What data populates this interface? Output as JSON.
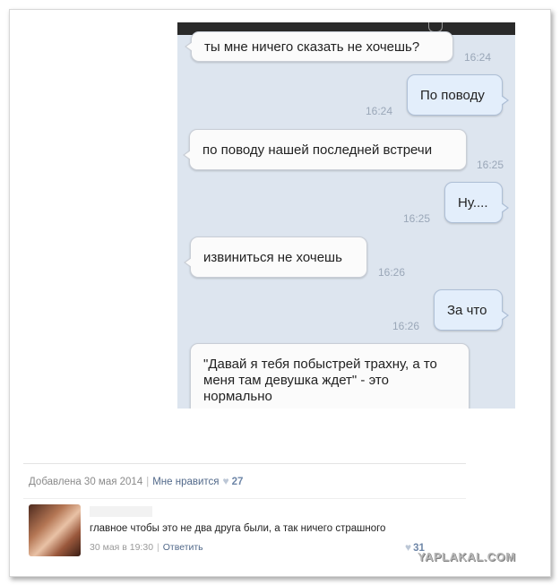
{
  "messages": [
    {
      "text": "ты мне ничего сказать не хочешь?",
      "time": "16:24",
      "dir": "in"
    },
    {
      "text": "По поводу",
      "time": "16:24",
      "dir": "out"
    },
    {
      "text": "по поводу нашей последней встречи",
      "time": "16:25",
      "dir": "in"
    },
    {
      "text": "Ну....",
      "time": "16:25",
      "dir": "out"
    },
    {
      "text": "извиниться не хочешь",
      "time": "16:26",
      "dir": "in"
    },
    {
      "text": "За что",
      "time": "16:26",
      "dir": "out"
    },
    {
      "text": "\"Давай я тебя побыстрей трахну, а то меня там девушка ждет\" - это нормально",
      "dir": "in"
    }
  ],
  "post": {
    "added_label": "Добавлена 30 мая 2014",
    "like_label": "Мне нравится",
    "like_count": "27"
  },
  "comment": {
    "text": "главное чтобы это не два друга были, а так ничего страшного",
    "date": "30 мая в 19:30",
    "reply_label": "Ответить",
    "likes": "31"
  },
  "watermark": "YAPLAKAL.COM",
  "colors": {
    "chat_bg": "#dde5ef",
    "link": "#52698a",
    "time": "#9aa7b8"
  }
}
